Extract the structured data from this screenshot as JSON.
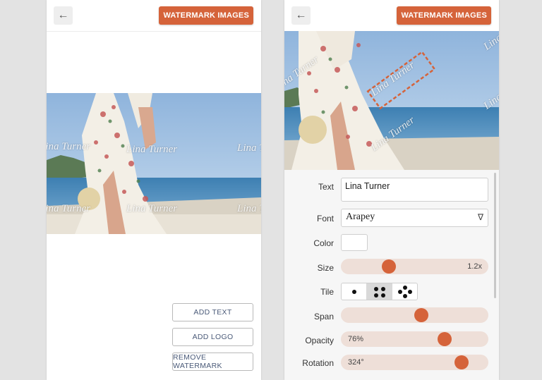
{
  "left_screen": {
    "back_icon": "arrow-left-icon",
    "watermark_button": "WATERMARK IMAGES",
    "watermark_texts": [
      "Lina Turner",
      "Lina Turner",
      "Lina Turner",
      "Lina Turner",
      "Lina Turner",
      "Lina Turner"
    ],
    "actions": {
      "add_text": "ADD TEXT",
      "add_logo": "ADD LOGO",
      "remove_watermark": "REMOVE WATERMARK"
    }
  },
  "right_screen": {
    "back_icon": "arrow-left-icon",
    "watermark_button": "WATERMARK IMAGES",
    "watermark_texts": [
      "Lina Turner",
      "Lina Turner",
      "Lina Turner",
      "Lina",
      "Lina"
    ],
    "settings": {
      "text_label": "Text",
      "text_value": "Lina Turner",
      "font_label": "Font",
      "font_value": "Arapey",
      "color_label": "Color",
      "color_value": "#ffffff",
      "size_label": "Size",
      "size_value": "1.2x",
      "size_fraction": 0.3,
      "tile_label": "Tile",
      "tile_options": [
        "single",
        "four",
        "five"
      ],
      "tile_selected": "four",
      "span_label": "Span",
      "span_fraction": 0.55,
      "opacity_label": "Opacity",
      "opacity_value": "76%",
      "opacity_fraction": 0.73,
      "rotation_label": "Rotation",
      "rotation_value": "324°",
      "rotation_fraction": 0.86
    }
  },
  "colors": {
    "accent": "#d5633a",
    "slider_track": "#eedfd8",
    "button_text": "#4a5a78"
  }
}
